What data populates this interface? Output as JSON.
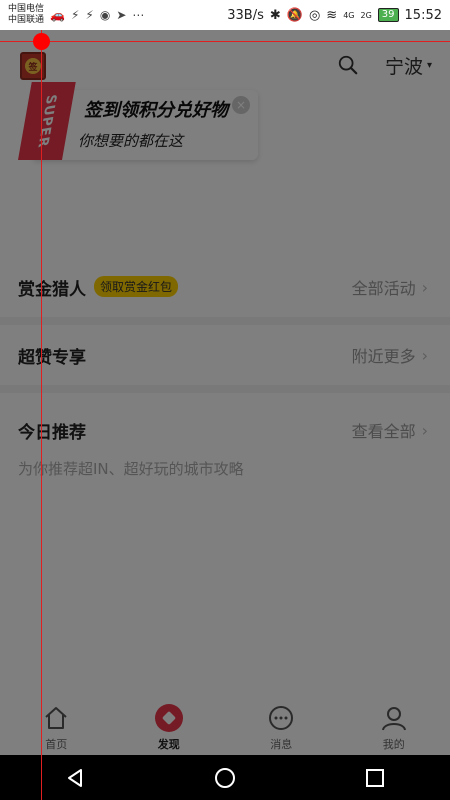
{
  "status_bar": {
    "carrier1": "中国电信",
    "carrier2": "中国联通",
    "speed": "33B/s",
    "net1": "4G",
    "net2": "2G",
    "battery": "39",
    "time": "15:52"
  },
  "header": {
    "sign_glyph": "签",
    "city": "宁波",
    "city_caret": "▾"
  },
  "promo": {
    "flag": "SUPER",
    "title": "签到领积分兑好物",
    "subtitle": "你想要的都在这",
    "close": "×"
  },
  "sections": {
    "bounty": {
      "title": "赏金猎人",
      "tag": "领取赏金红包",
      "more": "全部活动"
    },
    "super_deals": {
      "title": "超赞专享",
      "more": "附近更多"
    },
    "today": {
      "title": "今日推荐",
      "more": "查看全部",
      "desc": "为你推荐超IN、超好玩的城市攻略"
    }
  },
  "chevron": "›",
  "tabs": [
    {
      "label": "首页",
      "icon": "home-icon"
    },
    {
      "label": "发现",
      "icon": "discover-icon"
    },
    {
      "label": "消息",
      "icon": "message-icon"
    },
    {
      "label": "我的",
      "icon": "profile-icon"
    }
  ],
  "colors": {
    "accent": "#e8364a",
    "tag_yellow": "#ffd100",
    "overlay": "rgba(0,0,0,0.5)",
    "guide_red": "#e02020"
  }
}
